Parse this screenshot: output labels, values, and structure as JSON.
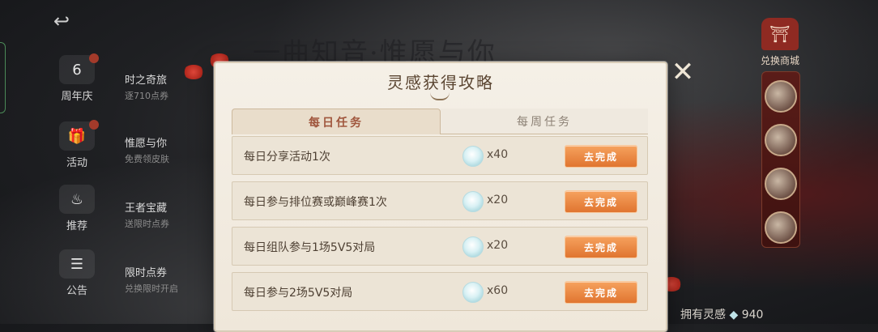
{
  "background": {
    "title": "一曲知音·惟愿与你"
  },
  "nav": {
    "back_icon": "back-arrow-icon",
    "items": [
      {
        "label": "周年庆",
        "icon": "anniversary-6-icon"
      },
      {
        "label": "活动",
        "icon": "gift-icon"
      },
      {
        "label": "推荐",
        "icon": "flame-icon"
      },
      {
        "label": "公告",
        "icon": "notice-icon"
      }
    ],
    "sub_items": [
      {
        "title": "时之奇旅",
        "desc": "逐710点券"
      },
      {
        "title": "惟愿与你",
        "desc": "免费领皮肤"
      },
      {
        "title": "王者宝藏",
        "desc": "送限时点券"
      },
      {
        "title": "限时点券",
        "desc": "兑换限时开启"
      }
    ]
  },
  "shop": {
    "label": "兑换商城",
    "icon": "shop-pavilion-icon"
  },
  "owned": {
    "label": "拥有灵感",
    "value": "940"
  },
  "modal": {
    "title": "灵感获得攻略",
    "close_icon": "close-x-icon",
    "tabs": [
      {
        "label": "每日任务",
        "active": true
      },
      {
        "label": "每周任务",
        "active": false
      }
    ],
    "button_label": "去完成",
    "tasks": [
      {
        "name": "每日分享活动1次",
        "reward": "x40"
      },
      {
        "name": "每日参与排位赛或巅峰赛1次",
        "reward": "x20"
      },
      {
        "name": "每日组队参与1场5V5对局",
        "reward": "x20"
      },
      {
        "name": "每日参与2场5V5对局",
        "reward": "x60"
      }
    ]
  },
  "colors": {
    "accent": "#e07530",
    "tab_active_text": "#a0563d",
    "modal_bg": "#f5f0e7"
  }
}
